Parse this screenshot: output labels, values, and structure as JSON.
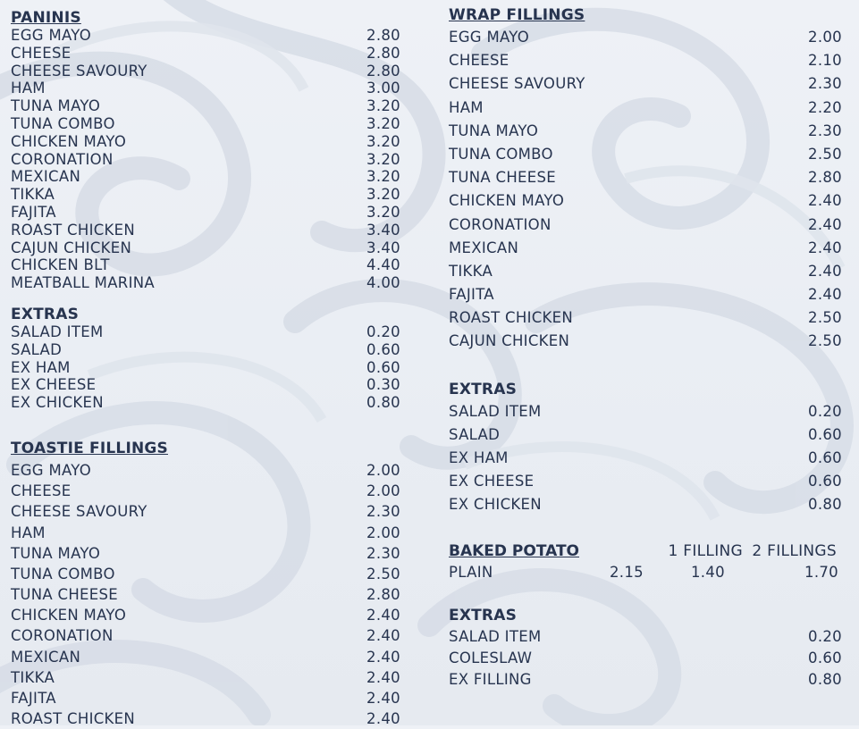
{
  "colors": {
    "text": "#27344f",
    "background": "#eaeef4",
    "swirl": "#d4dae4"
  },
  "paninis": {
    "title": "PANINIS",
    "items": [
      {
        "name": "EGG MAYO",
        "price": "2.80"
      },
      {
        "name": "CHEESE",
        "price": "2.80"
      },
      {
        "name": "CHEESE SAVOURY",
        "price": "2.80"
      },
      {
        "name": "HAM",
        "price": "3.00"
      },
      {
        "name": "TUNA MAYO",
        "price": "3.20"
      },
      {
        "name": "TUNA COMBO",
        "price": "3.20"
      },
      {
        "name": "CHICKEN MAYO",
        "price": "3.20"
      },
      {
        "name": "CORONATION",
        "price": "3.20"
      },
      {
        "name": "MEXICAN",
        "price": "3.20"
      },
      {
        "name": "TIKKA",
        "price": "3.20"
      },
      {
        "name": "FAJITA",
        "price": "3.20"
      },
      {
        "name": "ROAST CHICKEN",
        "price": "3.40"
      },
      {
        "name": "CAJUN CHICKEN",
        "price": "3.40"
      },
      {
        "name": "CHICKEN BLT",
        "price": "4.40"
      },
      {
        "name": "MEATBALL MARINA",
        "price": "4.00"
      }
    ]
  },
  "panini_extras": {
    "title": "EXTRAS",
    "items": [
      {
        "name": "SALAD ITEM",
        "price": "0.20"
      },
      {
        "name": "SALAD",
        "price": "0.60"
      },
      {
        "name": "EX HAM",
        "price": "0.60"
      },
      {
        "name": "EX CHEESE",
        "price": "0.30"
      },
      {
        "name": "EX CHICKEN",
        "price": "0.80"
      }
    ]
  },
  "toastie": {
    "title": "TOASTIE FILLINGS",
    "items": [
      {
        "name": "EGG MAYO",
        "price": "2.00"
      },
      {
        "name": "CHEESE",
        "price": "2.00"
      },
      {
        "name": "CHEESE SAVOURY",
        "price": "2.30"
      },
      {
        "name": "HAM",
        "price": "2.00"
      },
      {
        "name": "TUNA MAYO",
        "price": "2.30"
      },
      {
        "name": "TUNA COMBO",
        "price": "2.50"
      },
      {
        "name": "TUNA CHEESE",
        "price": "2.80"
      },
      {
        "name": "CHICKEN MAYO",
        "price": "2.40"
      },
      {
        "name": "CORONATION",
        "price": "2.40"
      },
      {
        "name": "MEXICAN",
        "price": "2.40"
      },
      {
        "name": "TIKKA",
        "price": "2.40"
      },
      {
        "name": "FAJITA",
        "price": "2.40"
      },
      {
        "name": "ROAST CHICKEN",
        "price": "2.40"
      }
    ]
  },
  "wrap": {
    "title": "WRAP FILLINGS",
    "items": [
      {
        "name": "EGG MAYO",
        "price": "2.00"
      },
      {
        "name": "CHEESE",
        "price": "2.10"
      },
      {
        "name": "CHEESE SAVOURY",
        "price": "2.30"
      },
      {
        "name": "HAM",
        "price": "2.20"
      },
      {
        "name": "TUNA MAYO",
        "price": "2.30"
      },
      {
        "name": "TUNA COMBO",
        "price": "2.50"
      },
      {
        "name": "TUNA CHEESE",
        "price": "2.80"
      },
      {
        "name": "CHICKEN MAYO",
        "price": "2.40"
      },
      {
        "name": "CORONATION",
        "price": "2.40"
      },
      {
        "name": "MEXICAN",
        "price": "2.40"
      },
      {
        "name": "TIKKA",
        "price": "2.40"
      },
      {
        "name": "FAJITA",
        "price": "2.40"
      },
      {
        "name": "ROAST CHICKEN",
        "price": "2.50"
      },
      {
        "name": "CAJUN CHICKEN",
        "price": "2.50"
      }
    ]
  },
  "wrap_extras": {
    "title": "EXTRAS",
    "items": [
      {
        "name": "SALAD ITEM",
        "price": "0.20"
      },
      {
        "name": "SALAD",
        "price": "0.60"
      },
      {
        "name": "EX HAM",
        "price": "0.60"
      },
      {
        "name": "EX CHEESE",
        "price": "0.60"
      },
      {
        "name": "EX CHICKEN",
        "price": "0.80"
      }
    ]
  },
  "baked_potato": {
    "title": "BAKED POTATO",
    "col1": "1 FILLING",
    "col2": "2 FILLINGS",
    "row": {
      "name": "PLAIN",
      "base": "2.15",
      "one": "1.40",
      "two": "1.70"
    }
  },
  "potato_extras": {
    "title": "EXTRAS",
    "items": [
      {
        "name": "SALAD ITEM",
        "price": "0.20"
      },
      {
        "name": "COLESLAW",
        "price": "0.60"
      },
      {
        "name": "EX FILLING",
        "price": "0.80"
      }
    ]
  }
}
